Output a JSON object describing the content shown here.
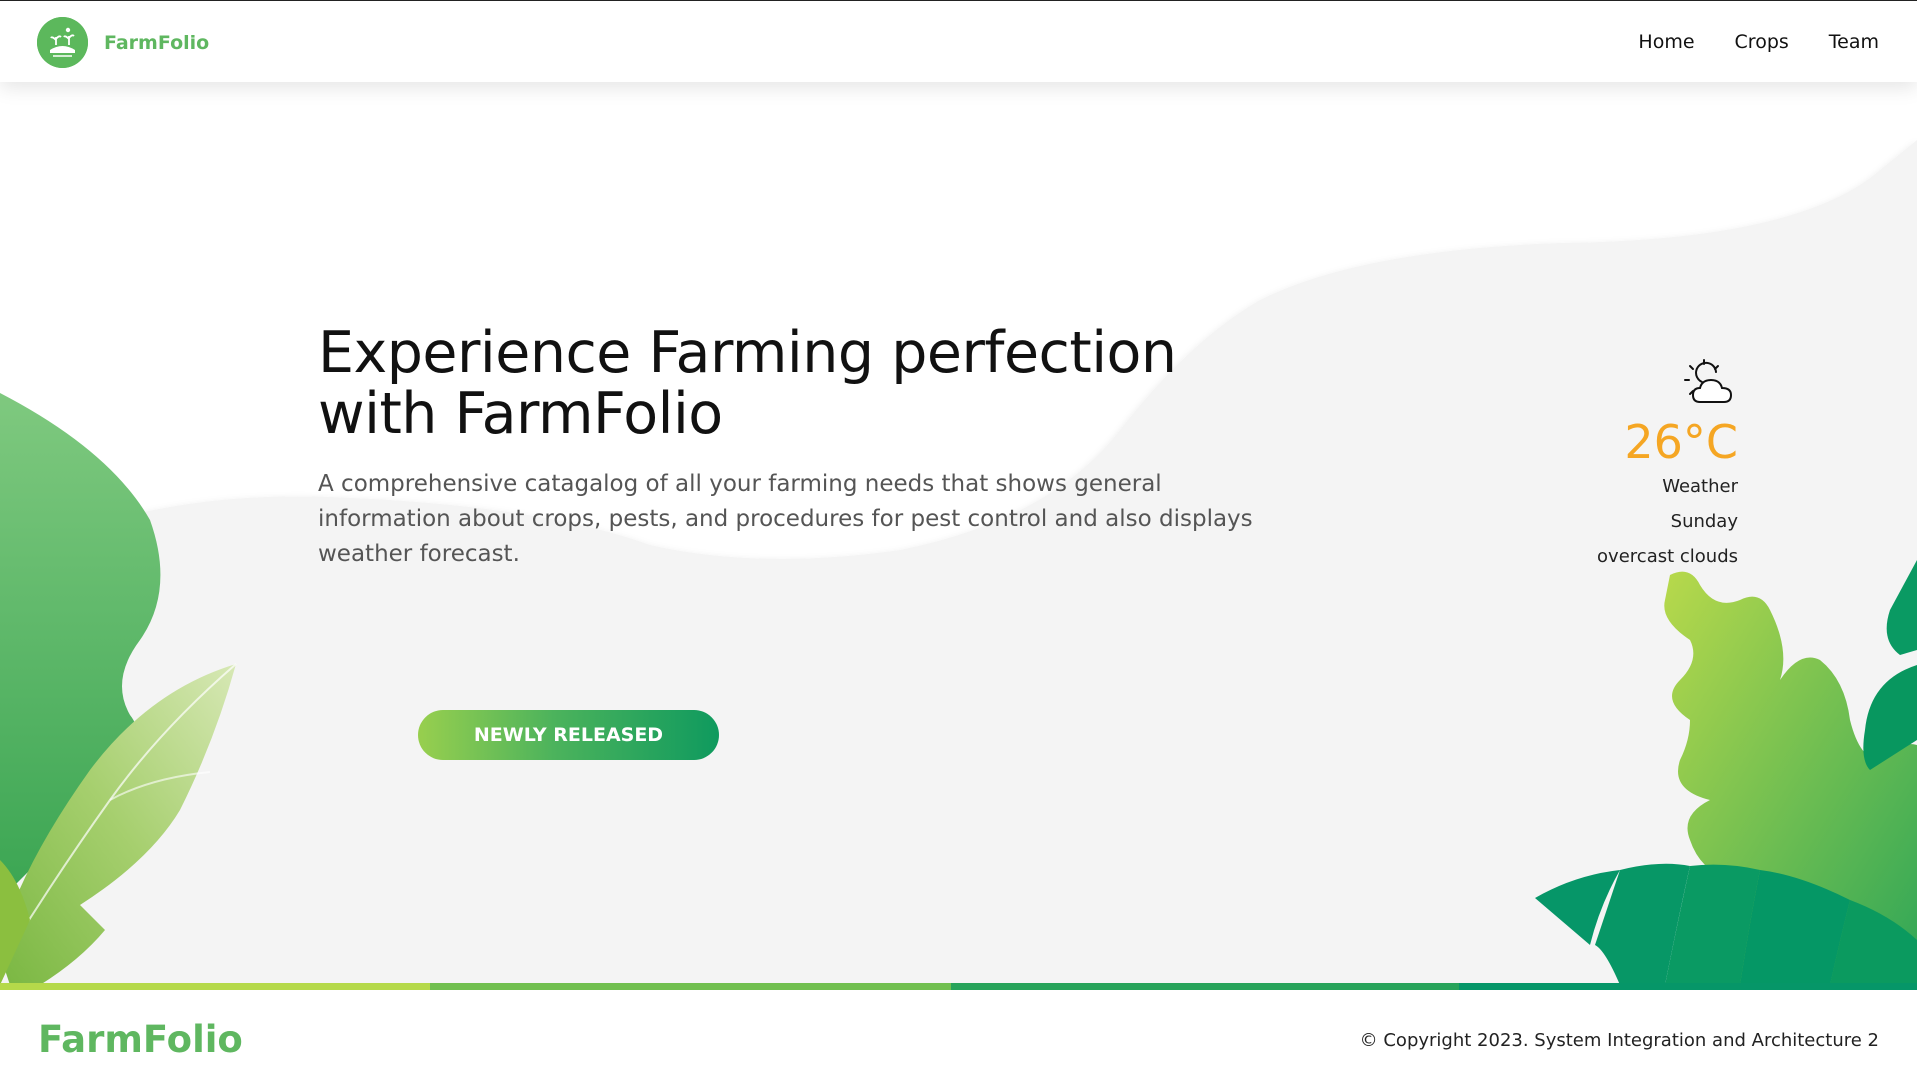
{
  "header": {
    "brand": "FarmFolio",
    "nav": [
      {
        "label": "Home"
      },
      {
        "label": "Crops"
      },
      {
        "label": "Team"
      }
    ]
  },
  "hero": {
    "title": "Experience Farming perfection with FarmFolio",
    "description": "A comprehensive catagalog of all your farming needs that shows general information about crops, pests, and procedures for pest control and also displays weather forecast.",
    "cta_label": "NEWLY RELEASED"
  },
  "weather": {
    "icon": "partly-cloudy-icon",
    "temperature": "26°C",
    "label": "Weather",
    "day": "Sunday",
    "condition": "overcast clouds"
  },
  "footer": {
    "brand": "FarmFolio",
    "copyright": "© Copyright 2023. System Integration and Architecture 2"
  },
  "colors": {
    "brand_green": "#5fb760",
    "temperature": "#f5a623",
    "hero_panel": "#f4f4f4",
    "strip": [
      "#b5d94a",
      "#71bf4f",
      "#27a35a",
      "#069668"
    ]
  }
}
